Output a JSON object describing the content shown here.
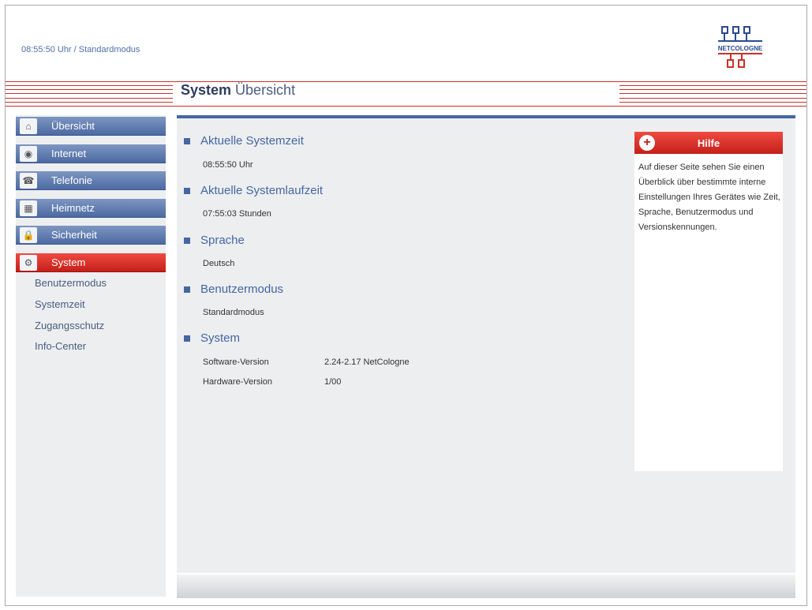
{
  "header": {
    "status": "08:55:50 Uhr / Standardmodus"
  },
  "logo": {
    "text": "NETCOLOGNE"
  },
  "page_title": {
    "bold": "System",
    "rest": " Übersicht"
  },
  "sidebar": {
    "items": [
      {
        "label": "Übersicht",
        "icon": "home-icon",
        "glyph": "⌂"
      },
      {
        "label": "Internet",
        "icon": "globe-icon",
        "glyph": "◉"
      },
      {
        "label": "Telefonie",
        "icon": "phone-icon",
        "glyph": "☎"
      },
      {
        "label": "Heimnetz",
        "icon": "network-icon",
        "glyph": "▦"
      },
      {
        "label": "Sicherheit",
        "icon": "lock-icon",
        "glyph": "🔒"
      },
      {
        "label": "System",
        "icon": "gears-icon",
        "glyph": "⚙"
      }
    ],
    "subitems": [
      "Benutzermodus",
      "Systemzeit",
      "Zugangsschutz",
      "Info-Center"
    ]
  },
  "sections": {
    "systemzeit": {
      "title": "Aktuelle Systemzeit",
      "value": "08:55:50 Uhr"
    },
    "laufzeit": {
      "title": "Aktuelle Systemlaufzeit",
      "value": "07:55:03 Stunden"
    },
    "sprache": {
      "title": "Sprache",
      "value": "Deutsch"
    },
    "benutzermodus": {
      "title": "Benutzermodus",
      "value": "Standardmodus"
    },
    "system": {
      "title": "System",
      "rows": [
        {
          "label": "Software-Version",
          "value": "2.24-2.17 NetCologne"
        },
        {
          "label": "Hardware-Version",
          "value": "1/00"
        }
      ]
    }
  },
  "help": {
    "title": "Hilfe",
    "text": "Auf dieser Seite sehen Sie einen Überblick über bestimmte interne Einstellungen Ihres Gerätes wie Zeit, Sprache, Benutzermodus und Versionskennungen."
  },
  "colors": {
    "nav_blue": "#4c6aa2",
    "active_red": "#c41f18",
    "heading_blue": "#4566a1",
    "panel_gray": "#eceef0"
  }
}
